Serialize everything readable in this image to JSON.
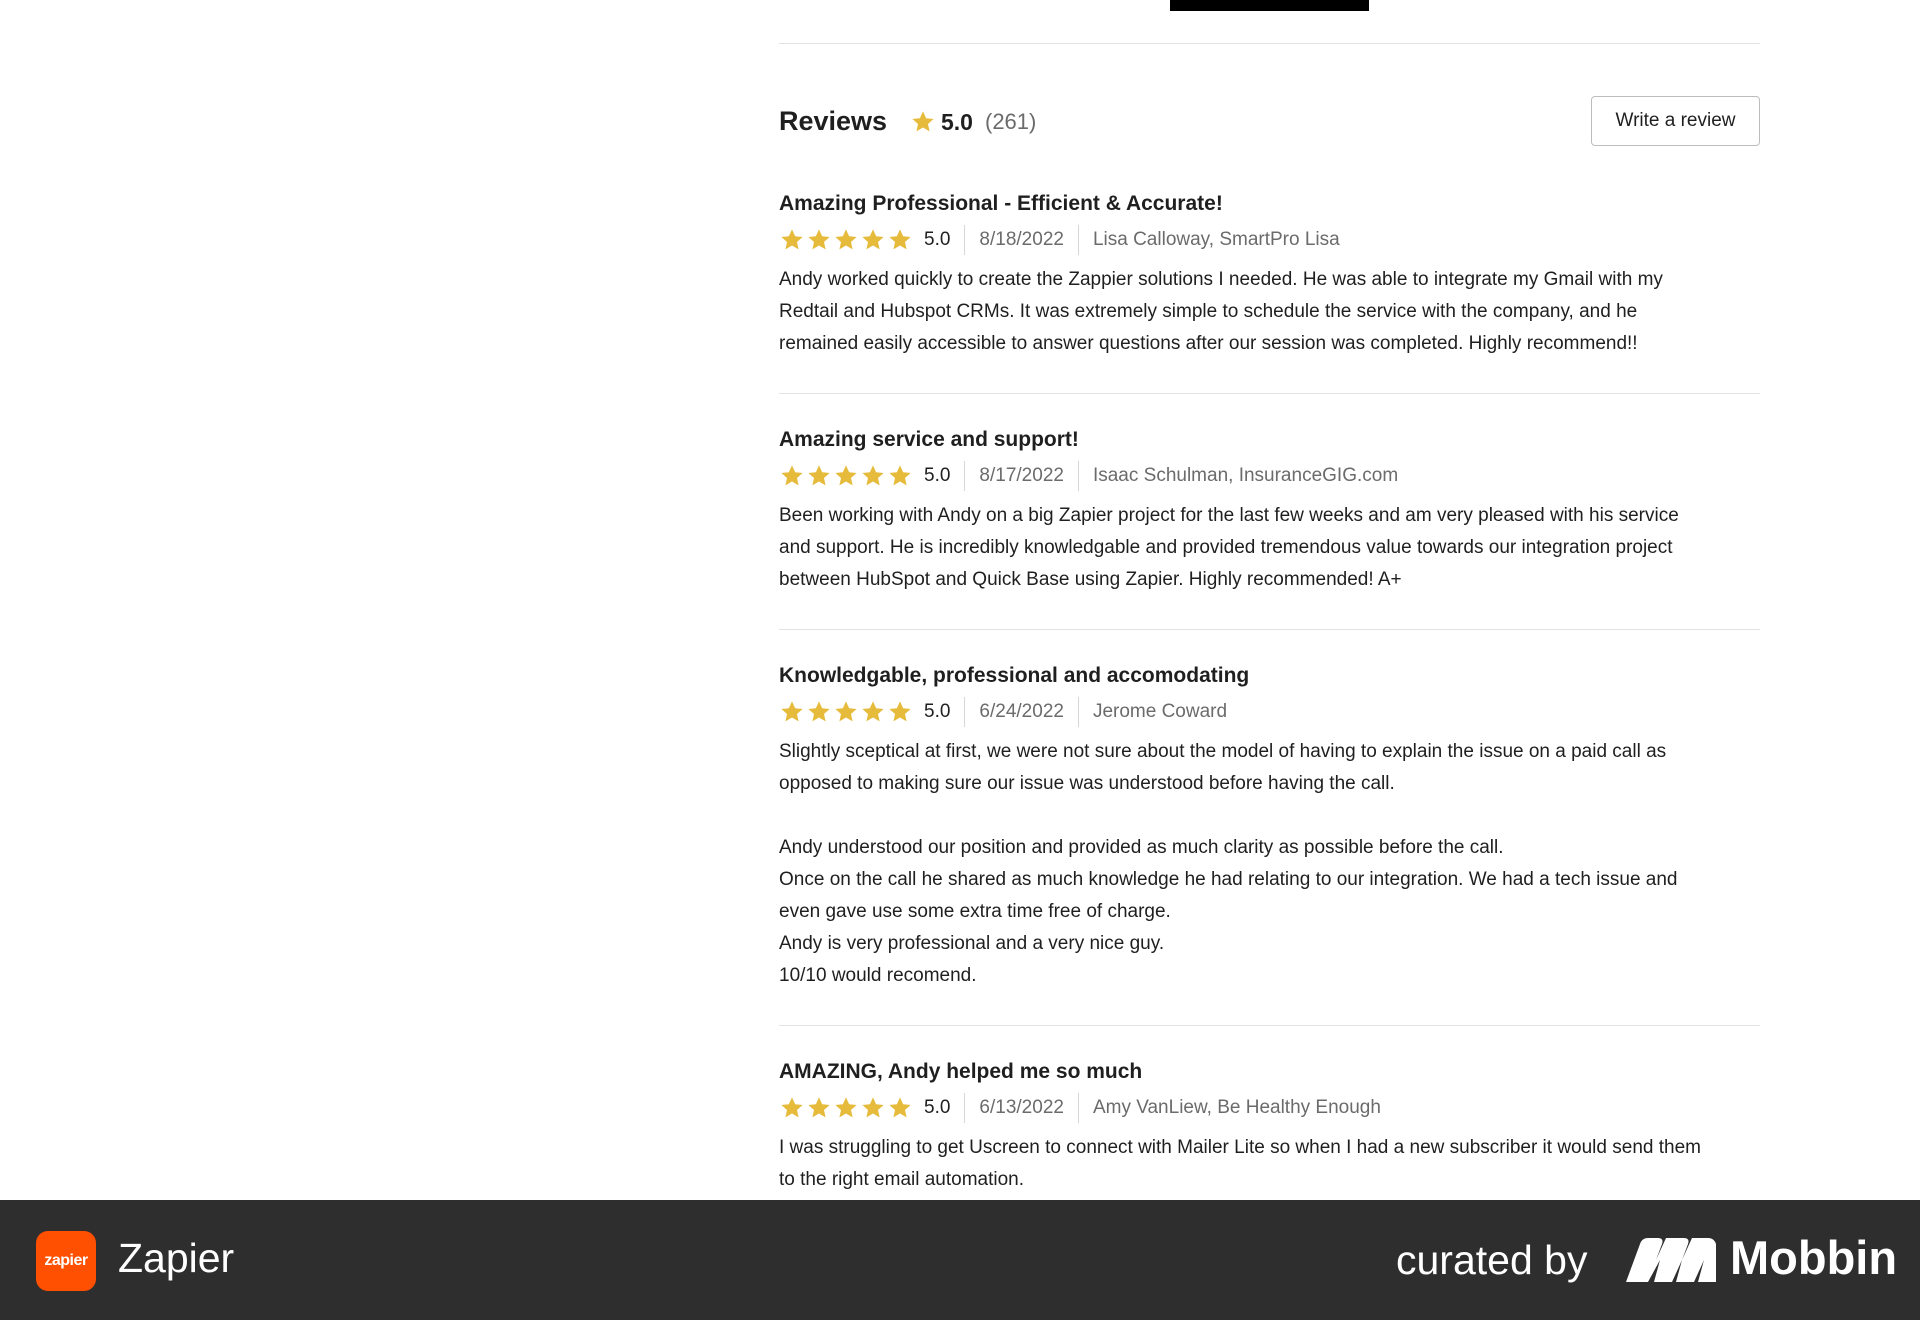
{
  "reviews": {
    "title": "Reviews",
    "average": "5.0",
    "count": "(261)",
    "write_label": "Write a review",
    "star_color": "#e6bb3c",
    "items": [
      {
        "title": "Amazing Professional - Efficient & Accurate!",
        "stars": 5,
        "rating": "5.0",
        "date": "8/18/2022",
        "author": "Lisa Calloway, SmartPro Lisa",
        "body": [
          "Andy worked quickly to create the Zappier solutions I needed. He was able to integrate my Gmail with my",
          "Redtail and Hubspot CRMs. It was extremely simple to schedule the service with the company, and he",
          "remained easily accessible to answer questions after our session was completed. Highly recommend!!"
        ]
      },
      {
        "title": "Amazing service and support!",
        "stars": 5,
        "rating": "5.0",
        "date": "8/17/2022",
        "author": "Isaac Schulman, InsuranceGIG.com",
        "body": [
          "Been working with Andy on a big Zapier project for the last few weeks and am very pleased with his service",
          "and support. He is incredibly knowledgable and provided tremendous value towards our integration project",
          "between HubSpot and Quick Base using Zapier. Highly recommended! A+"
        ]
      },
      {
        "title": "Knowledgable, professional and accomodating",
        "stars": 5,
        "rating": "5.0",
        "date": "6/24/2022",
        "author": "Jerome Coward",
        "body": [
          "Slightly sceptical at first, we were not sure about the model of having to explain the issue on a paid call as",
          "opposed to making sure our issue was understood before having the call.",
          "",
          "Andy understood our position and provided as much clarity as possible before the call.",
          "Once on the call he shared as much knowledge he had relating to our integration. We had a tech issue and",
          "even gave use some extra time free of charge.",
          "Andy is very professional and a very nice guy.",
          "10/10 would recomend."
        ]
      },
      {
        "title": "AMAZING, Andy helped me so much",
        "stars": 5,
        "rating": "5.0",
        "date": "6/13/2022",
        "author": "Amy VanLiew, Be Healthy Enough",
        "body": [
          "I was struggling to get Uscreen to connect with Mailer Lite so when I had a new subscriber it would send them",
          "to the right email automation."
        ]
      }
    ]
  },
  "footer": {
    "app_logo_text": "zapier",
    "app_name": "Zapier",
    "curated_label": "curated by",
    "curator_name": "Mobbin",
    "brand_color": "#ff4f00",
    "background": "#2e2e2e"
  }
}
